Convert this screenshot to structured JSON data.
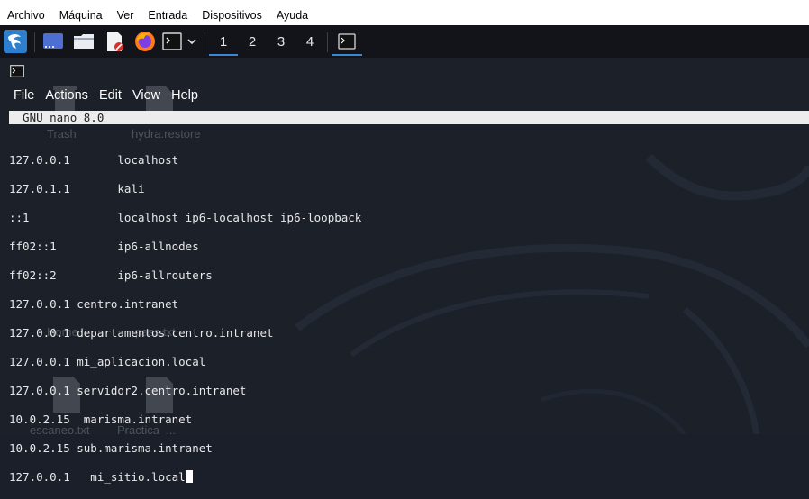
{
  "vm_menu": [
    "Archivo",
    "Máquina",
    "Ver",
    "Entrada",
    "Dispositivos",
    "Ayuda"
  ],
  "taskbar": {
    "icons": [
      "kali-dragon-icon",
      "desktop-icon",
      "files-icon",
      "text-editor-icon",
      "firefox-icon",
      "terminal-icon",
      "chevron-down-icon"
    ],
    "workspaces": [
      "1",
      "2",
      "3",
      "4"
    ],
    "active_workspace": "1",
    "running_app_icon": "terminal-icon"
  },
  "terminal_menu": [
    "File",
    "Actions",
    "Edit",
    "View",
    "Help"
  ],
  "nano": {
    "title": "  GNU nano 8.0",
    "lines": [
      "127.0.0.1       localhost",
      "127.0.1.1       kali",
      "::1             localhost ip6-localhost ip6-loopback",
      "ff02::1         ip6-allnodes",
      "ff02::2         ip6-allrouters",
      "127.0.0.1 centro.intranet",
      "127.0.0.1 departamentos.centro.intranet",
      "127.0.0.1 mi_aplicacion.local",
      "127.0.0.1 servidor2.centro.intranet",
      "10.0.2.15  marisma.intranet",
      "10.0.2.15 sub.marisma.intranet",
      "127.0.0.1   mi_sitio.local"
    ]
  },
  "desktop_labels": [
    "Trash",
    "hydra.restore",
    "Home",
    "pass.txt",
    "escaneo.txt",
    "Practica_..."
  ],
  "colors": {
    "accent": "#3d86d6",
    "terminal_bg": "#1b2029",
    "menubar_bg": "#ffffff",
    "taskbar_bg": "#121419"
  }
}
